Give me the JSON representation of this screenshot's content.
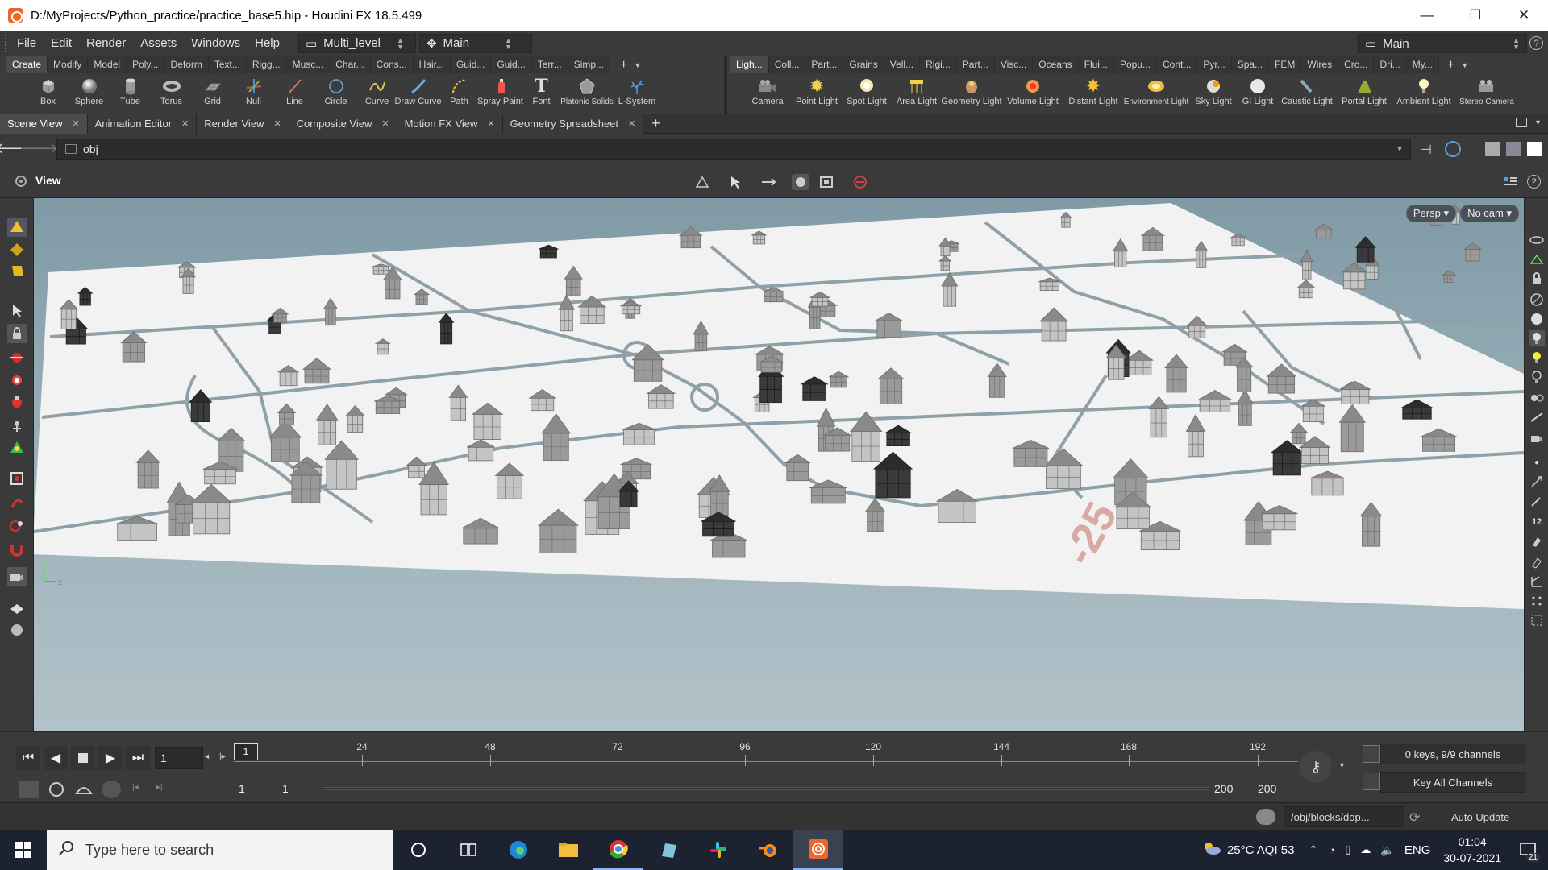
{
  "window": {
    "title": "D:/MyProjects/Python_practice/practice_base5.hip - Houdini FX 18.5.499",
    "controls": [
      "—",
      "☐",
      "✕"
    ]
  },
  "menubar": {
    "items": [
      "File",
      "Edit",
      "Render",
      "Assets",
      "Windows",
      "Help"
    ],
    "desktop": "Multi_level",
    "context": "Main",
    "right_desktop": "Main",
    "help": "?"
  },
  "shelf_left": {
    "tabs": [
      "Create",
      "Modify",
      "Model",
      "Poly...",
      "Deform",
      "Text...",
      "Rigg...",
      "Musc...",
      "Char...",
      "Cons...",
      "Hair...",
      "Guid...",
      "Guid...",
      "Terr...",
      "Simp..."
    ],
    "tools": [
      {
        "label": "Box",
        "icon": "box-icon"
      },
      {
        "label": "Sphere",
        "icon": "sphere-icon"
      },
      {
        "label": "Tube",
        "icon": "tube-icon"
      },
      {
        "label": "Torus",
        "icon": "torus-icon"
      },
      {
        "label": "Grid",
        "icon": "grid-icon"
      },
      {
        "label": "Null",
        "icon": "null-icon"
      },
      {
        "label": "Line",
        "icon": "line-icon"
      },
      {
        "label": "Circle",
        "icon": "circle-icon"
      },
      {
        "label": "Curve",
        "icon": "curve-icon"
      },
      {
        "label": "Draw Curve",
        "icon": "draw-curve-icon"
      },
      {
        "label": "Path",
        "icon": "path-icon"
      },
      {
        "label": "Spray Paint",
        "icon": "spray-paint-icon"
      },
      {
        "label": "Font",
        "icon": "font-icon"
      },
      {
        "label": "Platonic Solids",
        "icon": "platonic-solids-icon"
      },
      {
        "label": "L-System",
        "icon": "l-system-icon"
      }
    ]
  },
  "shelf_right": {
    "tabs": [
      "Ligh...",
      "Coll...",
      "Part...",
      "Grains",
      "Vell...",
      "Rigi...",
      "Part...",
      "Visc...",
      "Oceans",
      "Flui...",
      "Popu...",
      "Cont...",
      "Pyr...",
      "Spa...",
      "FEM",
      "Wires",
      "Cro...",
      "Dri...",
      "My..."
    ],
    "tools": [
      {
        "label": "Camera",
        "icon": "camera-icon"
      },
      {
        "label": "Point Light",
        "icon": "point-light-icon"
      },
      {
        "label": "Spot Light",
        "icon": "spot-light-icon"
      },
      {
        "label": "Area Light",
        "icon": "area-light-icon"
      },
      {
        "label": "Geometry Light",
        "icon": "geometry-light-icon"
      },
      {
        "label": "Volume Light",
        "icon": "volume-light-icon"
      },
      {
        "label": "Distant Light",
        "icon": "distant-light-icon"
      },
      {
        "label": "Environment Light",
        "icon": "environment-light-icon"
      },
      {
        "label": "Sky Light",
        "icon": "sky-light-icon"
      },
      {
        "label": "GI Light",
        "icon": "gi-light-icon"
      },
      {
        "label": "Caustic Light",
        "icon": "caustic-light-icon"
      },
      {
        "label": "Portal Light",
        "icon": "portal-light-icon"
      },
      {
        "label": "Ambient Light",
        "icon": "ambient-light-icon"
      },
      {
        "label": "Stereo Camera",
        "icon": "stereo-camera-icon"
      }
    ]
  },
  "pane_tabs": [
    {
      "label": "Scene View",
      "active": true
    },
    {
      "label": "Animation Editor",
      "active": false
    },
    {
      "label": "Render View",
      "active": false
    },
    {
      "label": "Composite View",
      "active": false
    },
    {
      "label": "Motion FX View",
      "active": false
    },
    {
      "label": "Geometry Spreadsheet",
      "active": false
    }
  ],
  "pathbar": {
    "path": "obj"
  },
  "view": {
    "title": "View",
    "persp_label": "Persp ▾",
    "cam_label": "No cam ▾",
    "ground_label": "-25"
  },
  "timeline": {
    "current_frame": "1",
    "ruler_marker": "1",
    "ticks": [
      "24",
      "48",
      "72",
      "96",
      "120",
      "144",
      "168",
      "192"
    ],
    "range_start": "1",
    "range_start2": "1",
    "range_end": "200",
    "range_end2": "200",
    "keys_info": "0 keys, 9/9 channels",
    "key_all": "Key All Channels"
  },
  "statusbar": {
    "path": "/obj/blocks/dop...",
    "auto_update": "Auto Update"
  },
  "taskbar": {
    "search_placeholder": "Type here to search",
    "weather": "25°C AQI 53",
    "lang": "ENG",
    "time": "01:04",
    "date": "30-07-2021",
    "notifications": "21"
  },
  "colors": {
    "houdini_orange": "#e8692b",
    "ui_bg": "#3a3a3a",
    "viewport_sky": "#99afb8",
    "ground": "#f2f2f2",
    "taskbar": "#1c2230"
  }
}
